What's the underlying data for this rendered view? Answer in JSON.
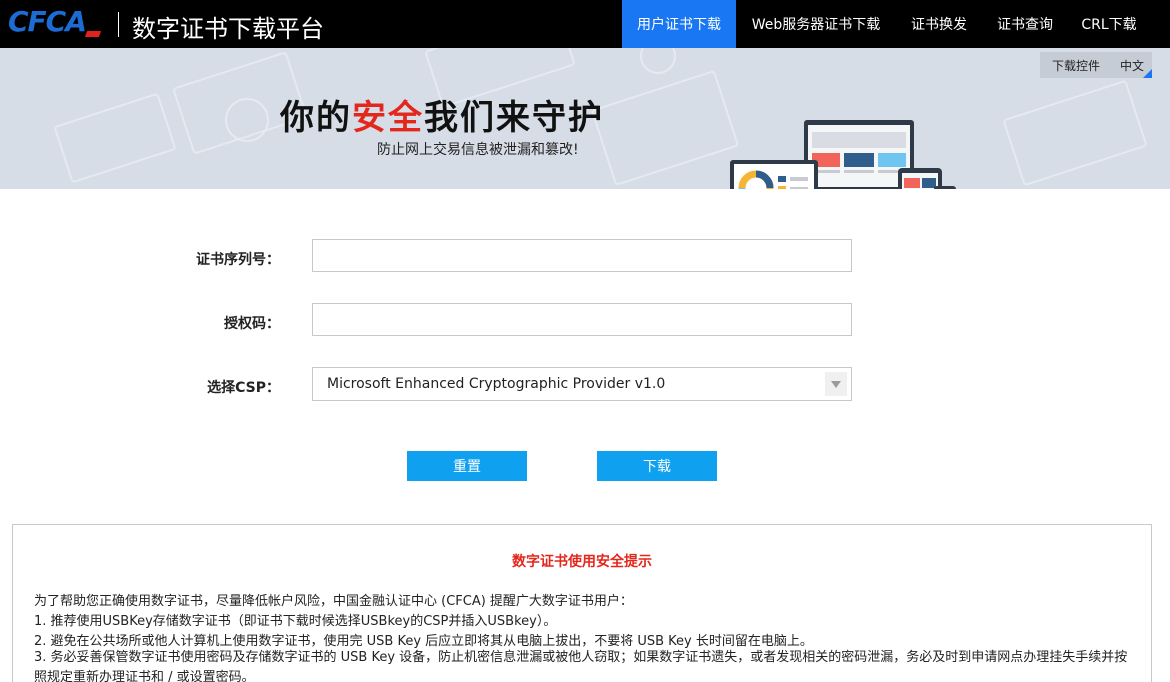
{
  "header": {
    "logo_text": "CFCA",
    "site_title": "数字证书下载平台",
    "nav": [
      {
        "label": "用户证书下载",
        "active": true
      },
      {
        "label": "Web服务器证书下载",
        "active": false
      },
      {
        "label": "证书换发",
        "active": false
      },
      {
        "label": "证书查询",
        "active": false
      },
      {
        "label": "CRL下载",
        "active": false
      }
    ]
  },
  "banner": {
    "slogan_part1": "你的",
    "slogan_red": "安全",
    "slogan_part2": "我们来守护",
    "subslogan": "防止网上交易信息被泄漏和篡改!",
    "download_control": "下载控件",
    "language": "中文"
  },
  "form": {
    "serial_label": "证书序列号：",
    "serial_value": "",
    "auth_label": "授权码：",
    "auth_value": "",
    "csp_label": "选择CSP：",
    "csp_selected": "Microsoft Enhanced Cryptographic Provider v1.0",
    "reset_label": "重置",
    "download_label": "下载"
  },
  "notice": {
    "title": "数字证书使用安全提示",
    "intro": "为了帮助您正确使用数字证书，尽量降低帐户风险，中国金融认证中心 (CFCA) 提醒广大数字证书用户：",
    "item1": "1. 推荐使用USBKey存储数字证书（即证书下载时候选择USBkey的CSP并插入USBkey）。",
    "item2": "2. 避免在公共场所或他人计算机上使用数字证书，使用完 USB Key 后应立即将其从电脑上拔出，不要将 USB Key 长时间留在电脑上。",
    "item3": "3. 务必妥善保管数字证书使用密码及存储数字证书的 USB Key 设备，防止机密信息泄漏或被他人窃取；如果数字证书遗失，或者发现相关的密码泄漏，务必及时到申请网点办理挂失手续并按照规定重新办理证书和 / 或设置密码。"
  },
  "colors": {
    "accent": "#1977f3",
    "button": "#0fa0ef",
    "red": "#e4271c",
    "banner_bg": "#d7dde6"
  }
}
